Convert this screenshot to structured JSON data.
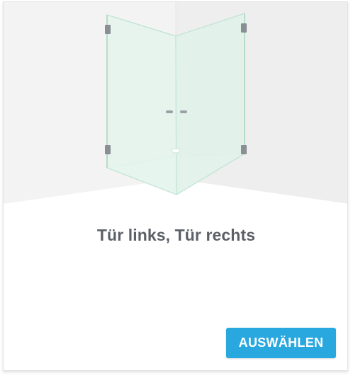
{
  "card": {
    "title": "Tür links, Tür rechts",
    "select_label": "AUSWÄHLEN",
    "image_icon": "corner-shower-enclosure-icon"
  },
  "colors": {
    "button_bg": "#29a8e0",
    "button_text": "#ffffff",
    "title_text": "#5b6068",
    "wall": "#f2f2f2",
    "floor": "#ffffff",
    "glass": "#e3f3ec"
  }
}
